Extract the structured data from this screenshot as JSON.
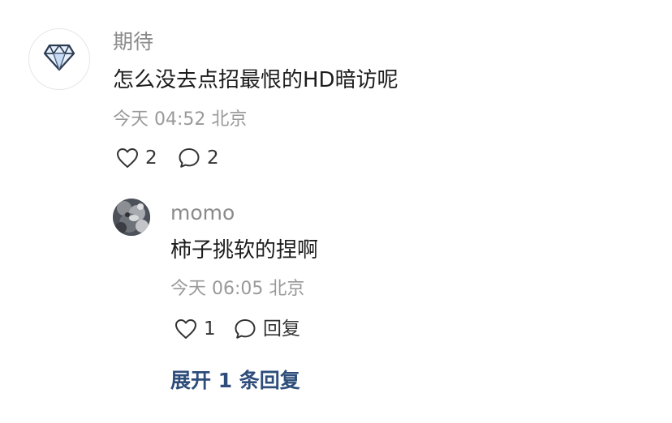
{
  "comment": {
    "avatar_icon": "diamond-icon",
    "username": "期待",
    "text": "怎么没去点招最恨的HD暗访呢",
    "meta": "今天 04:52 北京",
    "like_count": "2",
    "reply_count": "2",
    "icons": {
      "like": "heart-icon",
      "reply": "speech-bubble-icon"
    }
  },
  "reply": {
    "avatar_icon": "user-avatar-photo",
    "username": "momo",
    "text": "柿子挑软的捏啊",
    "meta": "今天 06:05 北京",
    "like_count": "1",
    "reply_label": "回复",
    "icons": {
      "like": "heart-icon",
      "reply": "speech-bubble-icon"
    }
  },
  "expand": {
    "label": "展开 1 条回复"
  },
  "colors": {
    "username": "#8a8a8a",
    "meta": "#999999",
    "text": "#1c1c1c",
    "link": "#2e4d7a"
  }
}
